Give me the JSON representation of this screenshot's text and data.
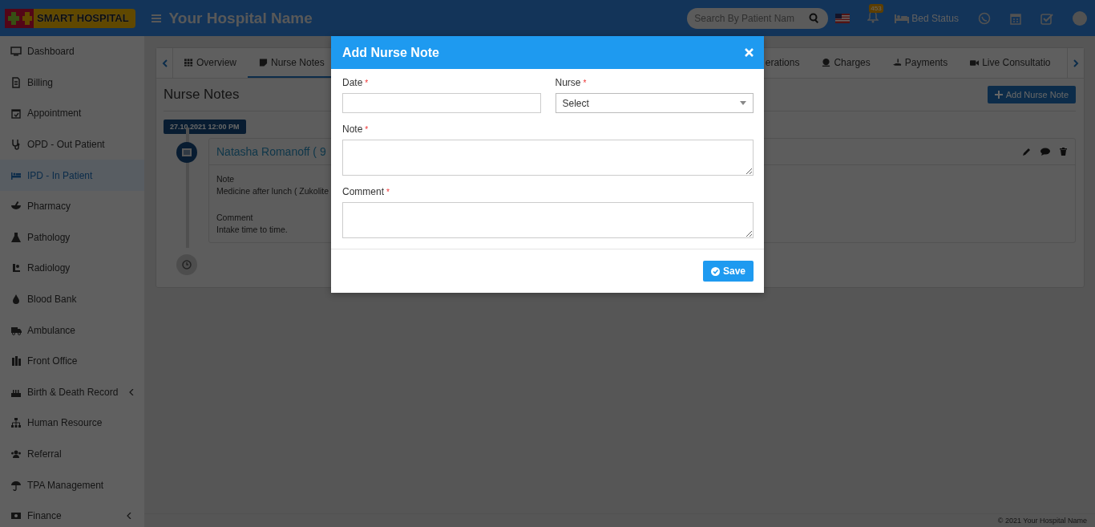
{
  "header": {
    "logo_text": "SMART HOSPITAL",
    "title": "Your Hospital Name",
    "search": {
      "placeholder": "Search By Patient Nam"
    },
    "notification_count": "453",
    "bed_status": "Bed Status"
  },
  "sidebar": {
    "items": [
      {
        "label": "Dashboard",
        "selected": false,
        "expandable": false
      },
      {
        "label": "Billing",
        "selected": false,
        "expandable": false
      },
      {
        "label": "Appointment",
        "selected": false,
        "expandable": false
      },
      {
        "label": "OPD - Out Patient",
        "selected": false,
        "expandable": false
      },
      {
        "label": "IPD - In Patient",
        "selected": true,
        "expandable": false
      },
      {
        "label": "Pharmacy",
        "selected": false,
        "expandable": false
      },
      {
        "label": "Pathology",
        "selected": false,
        "expandable": false
      },
      {
        "label": "Radiology",
        "selected": false,
        "expandable": false
      },
      {
        "label": "Blood Bank",
        "selected": false,
        "expandable": false
      },
      {
        "label": "Ambulance",
        "selected": false,
        "expandable": false
      },
      {
        "label": "Front Office",
        "selected": false,
        "expandable": false
      },
      {
        "label": "Birth & Death Record",
        "selected": false,
        "expandable": true
      },
      {
        "label": "Human Resource",
        "selected": false,
        "expandable": false
      },
      {
        "label": "Referral",
        "selected": false,
        "expandable": false
      },
      {
        "label": "TPA Management",
        "selected": false,
        "expandable": false
      },
      {
        "label": "Finance",
        "selected": false,
        "expandable": true
      }
    ]
  },
  "tabs": [
    {
      "label": "Overview",
      "selected": false
    },
    {
      "label": "Nurse Notes",
      "selected": true
    },
    {
      "label": "erations",
      "selected": false
    },
    {
      "label": "Charges",
      "selected": false
    },
    {
      "label": "Payments",
      "selected": false
    },
    {
      "label": "Live Consultatio",
      "selected": false
    }
  ],
  "section": {
    "title": "Nurse Notes",
    "add_button": "Add Nurse Note"
  },
  "timeline": {
    "date": "27.10.2021 12:00 PM",
    "entry": {
      "nurse": "Natasha Romanoff ( 9",
      "note_label": "Note",
      "note_text": "Medicine after lunch ( Zukolite",
      "comment_label": "Comment",
      "comment_text": "Intake time to time."
    }
  },
  "modal": {
    "title": "Add Nurse Note",
    "fields": [
      {
        "kind": "text",
        "label": "Date",
        "required_mark": "*"
      },
      {
        "kind": "select",
        "label": "Nurse",
        "required_mark": "*",
        "value": "Select"
      },
      {
        "kind": "textarea",
        "label": "Note",
        "required_mark": "*"
      },
      {
        "kind": "textarea",
        "label": "Comment",
        "required_mark": "*"
      }
    ],
    "save_button": "Save"
  },
  "footer": "© 2021 Your Hospital Name"
}
